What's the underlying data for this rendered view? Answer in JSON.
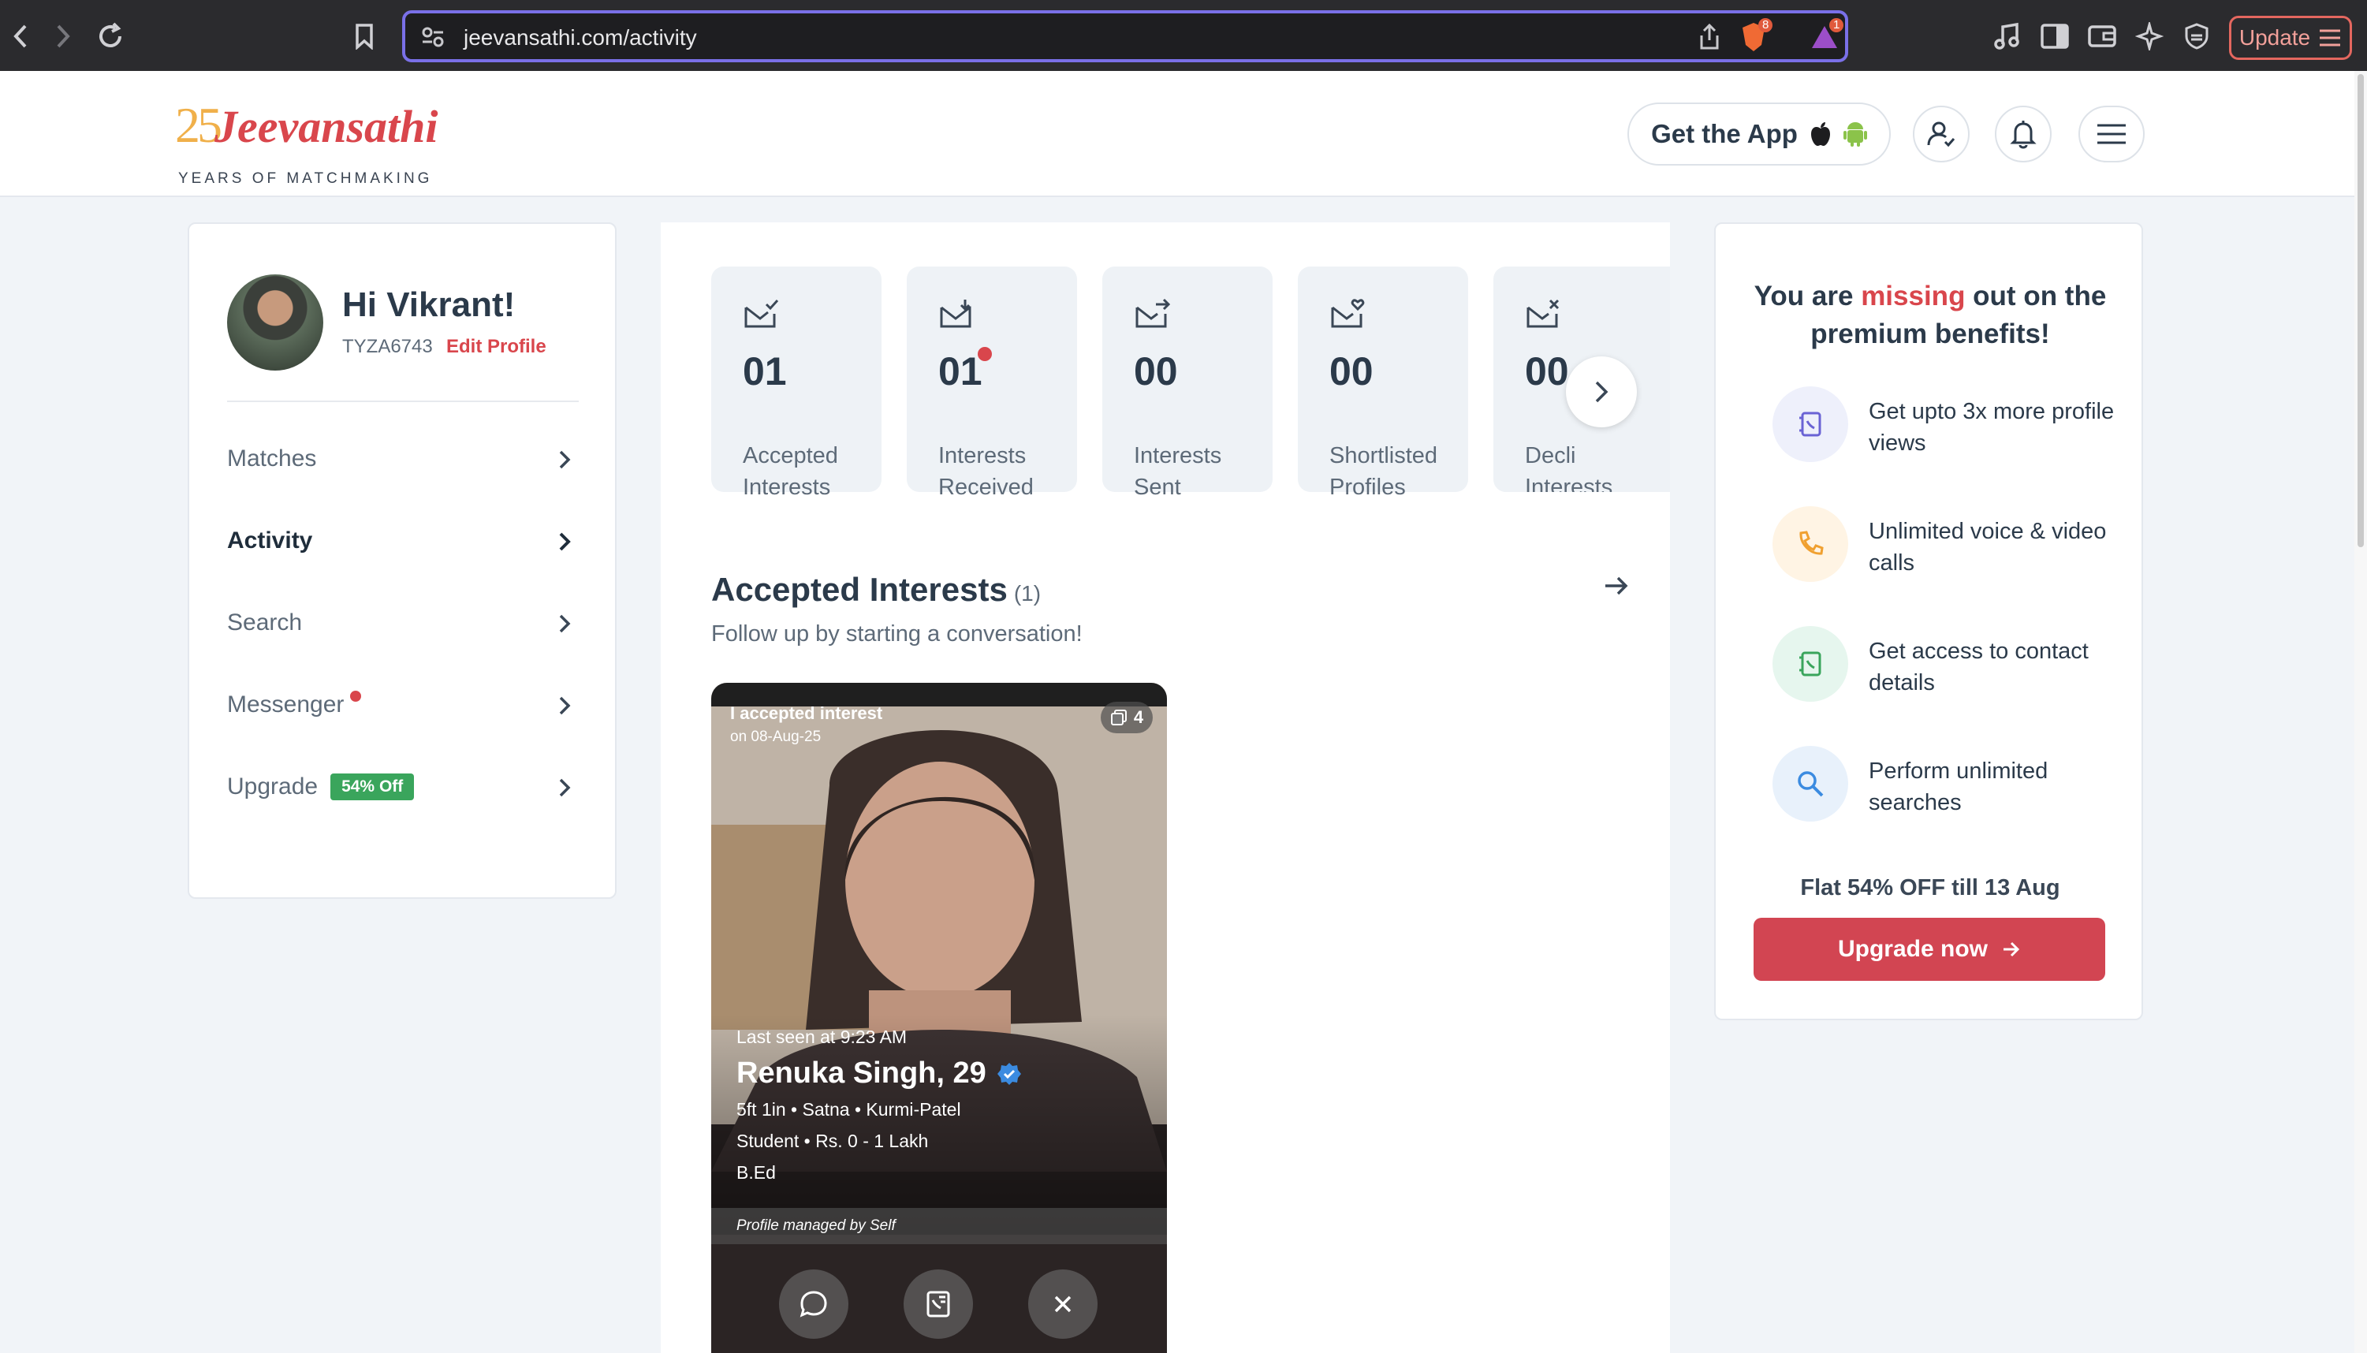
{
  "browser": {
    "url": "jeevansathi.com/activity",
    "brave_count": "8",
    "alert_count": "1",
    "update_label": "Update"
  },
  "header": {
    "logo_number": "25",
    "logo_brand": "Jeevansathi",
    "logo_tagline": "YEARS OF MATCHMAKING",
    "get_app_label": "Get the App"
  },
  "sidebar": {
    "greeting": "Hi Vikrant!",
    "user_id": "TYZA6743",
    "edit_profile": "Edit Profile",
    "items": [
      {
        "label": "Matches"
      },
      {
        "label": "Activity"
      },
      {
        "label": "Search"
      },
      {
        "label": "Messenger"
      },
      {
        "label": "Upgrade",
        "tag": "54% Off"
      }
    ]
  },
  "stats": [
    {
      "number": "01",
      "line1": "Accepted",
      "line2": "Interests"
    },
    {
      "number": "01",
      "line1": "Interests",
      "line2": "Received"
    },
    {
      "number": "00",
      "line1": "Interests",
      "line2": "Sent"
    },
    {
      "number": "00",
      "line1": "Shortlisted",
      "line2": "Profiles"
    },
    {
      "number": "00",
      "line1": "Decli",
      "line2": "Interests"
    }
  ],
  "section": {
    "title": "Accepted Interests",
    "count": "(1)",
    "subtitle": "Follow up by starting a conversation!"
  },
  "profile_card": {
    "status": "I accepted interest",
    "date": "on 08-Aug-25",
    "photo_count": "4",
    "last_seen": "Last seen at 9:23 AM",
    "name": "Renuka Singh, 29",
    "line1": "5ft 1in  •  Satna  •  Kurmi-Patel",
    "line2": "Student  •  Rs. 0 - 1 Lakh",
    "line3": "B.Ed",
    "managed": "Profile managed by Self"
  },
  "premium": {
    "title_pre": "You are ",
    "title_highlight": "missing",
    "title_post": " out on the premium benefits!",
    "benefits": [
      {
        "text": "Get upto 3x more profile views",
        "icon": "profile-views-icon"
      },
      {
        "text": "Unlimited voice & video calls",
        "icon": "phone-icon"
      },
      {
        "text": "Get access to contact details",
        "icon": "contact-card-icon"
      },
      {
        "text": "Perform unlimited searches",
        "icon": "search-icon"
      }
    ],
    "offer": "Flat 54% OFF till 13 Aug",
    "cta": "Upgrade now"
  },
  "colors": {
    "accent": "#d9464c",
    "green_tag": "#3aa55c",
    "cta": "#d24552"
  }
}
